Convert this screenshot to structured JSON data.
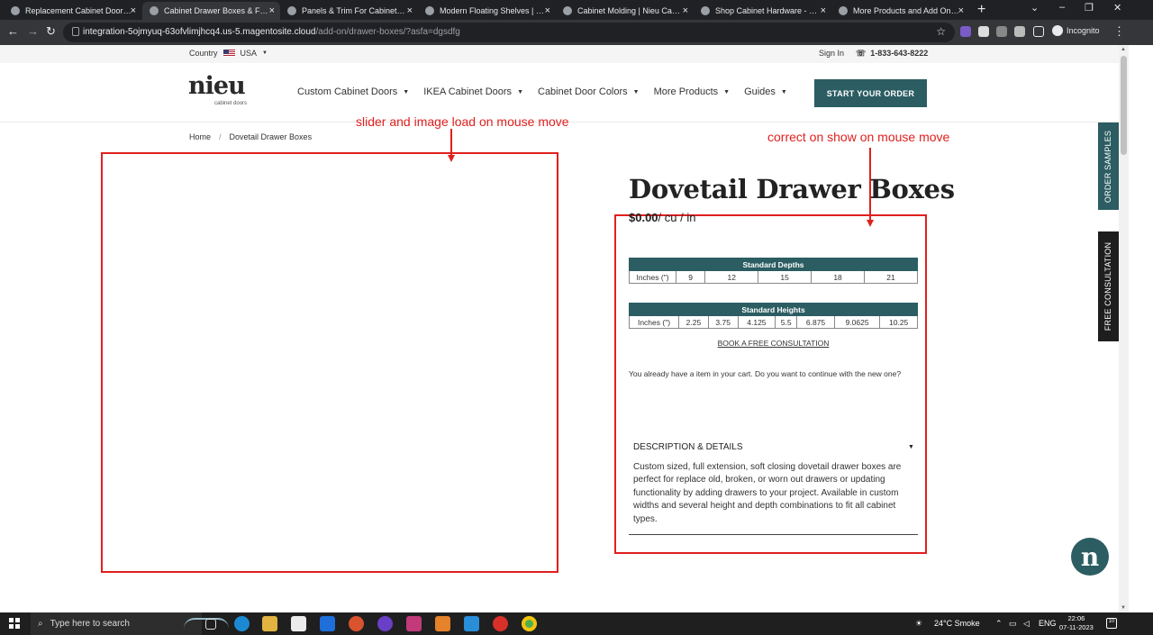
{
  "browser": {
    "tabs": [
      {
        "title": "Replacement Cabinet Doors Or",
        "active": false
      },
      {
        "title": "Cabinet Drawer Boxes & Front",
        "active": true
      },
      {
        "title": "Panels & Trim For Cabinets | Ni",
        "active": false
      },
      {
        "title": "Modern Floating Shelves | Nieu",
        "active": false
      },
      {
        "title": "Cabinet Molding | Nieu Cabine",
        "active": false
      },
      {
        "title": "Shop Cabinet Hardware - Knob",
        "active": false
      },
      {
        "title": "More Products and Add Ons | N",
        "active": false
      }
    ],
    "url_host": "integration-5ojmyuq-63ofvlimjhcq4.us-5.magentosite.cloud",
    "url_path": "/add-on/drawer-boxes/?asfa=dgsdfg",
    "profile_label": "Incognito"
  },
  "topbar": {
    "country_label": "Country",
    "country_value": "USA",
    "signin": "Sign In",
    "phone": "1-833-643-8222"
  },
  "header": {
    "logo_word": "nieu",
    "logo_sub": "cabinet doors",
    "nav": [
      "Custom Cabinet Doors",
      "IKEA Cabinet Doors",
      "Cabinet Door Colors",
      "More Products",
      "Guides"
    ],
    "cta": "START YOUR ORDER"
  },
  "side_tabs": {
    "samples": "ORDER SAMPLES",
    "consultation": "FREE CONSULTATION"
  },
  "breadcrumb": {
    "home": "Home",
    "separator": "/",
    "current": "Dovetail Drawer Boxes"
  },
  "annotations": {
    "left_note": "slider and image load on mouse move",
    "right_note": "correct on show on mouse move"
  },
  "product": {
    "title": "Dovetail Drawer Boxes",
    "price": "$0.00",
    "price_unit": "/ cu / in",
    "depths": {
      "title": "Standard Depths",
      "row_label": "Inches (\")",
      "values": [
        "9",
        "12",
        "15",
        "18",
        "21"
      ]
    },
    "heights": {
      "title": "Standard Heights",
      "row_label": "Inches (\")",
      "values": [
        "2.25",
        "3.75",
        "4.125",
        "5.5",
        "6.875",
        "9.0625",
        "10.25"
      ]
    },
    "book_link": "BOOK A FREE CONSULTATION",
    "cart_message": "You already have a item in your cart. Do you want to continue with the new one?",
    "description_heading": "DESCRIPTION & DETAILS",
    "description": "Custom sized, full extension, soft closing dovetail drawer boxes are perfect for replace old, broken, or worn out drawers or updating functionality by adding drawers to your project. Available in custom widths and several height and depth combinations to fit all cabinet types."
  },
  "chat": {
    "glyph": "n"
  },
  "taskbar": {
    "search_placeholder": "Type here to search",
    "weather": "24°C  Smoke",
    "lang": "ENG",
    "time": "22:06",
    "date": "07-11-2023",
    "notif_count": "10"
  },
  "colors": {
    "brand_teal": "#2b5d62",
    "annotation_red": "#e0201e"
  }
}
